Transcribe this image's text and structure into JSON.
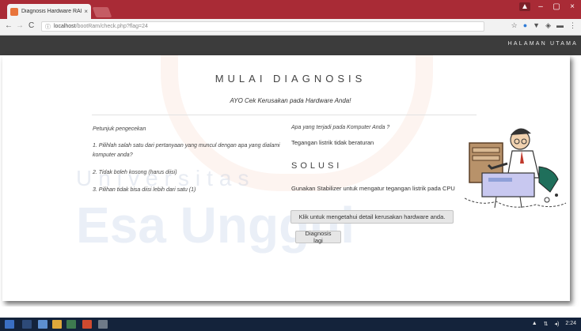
{
  "browser": {
    "tab_title": "Diagnosis Hardware RAI",
    "tab_close": "×",
    "url_host": "localhost",
    "url_path": "/bootRam/check.php?flag=24",
    "nav_back": "←",
    "nav_forward": "→",
    "nav_reload": "C",
    "info_icon": "ⓘ",
    "window_controls": {
      "minimize": "–",
      "maximize": "▢",
      "close": "×"
    },
    "extensions": [
      "☆",
      "●",
      "▼",
      "◈",
      "▬",
      "⋮"
    ]
  },
  "navbar": {
    "link": "HALAMAN UTAMA"
  },
  "page": {
    "title": "MULAI DIAGNOSIS",
    "subtitle": "AYO Cek Kerusakan pada Hardware Anda!",
    "instructions": {
      "heading": "Petunjuk pengecekan",
      "items": [
        "1. Pilihlah salah satu dari pertanyaan yang muncul dengan apa yang dialami komputer anda?",
        "2. Tidak boleh kosong (harus diisi)",
        "3. Pilihan tidak bisa diisi lebih dari satu (1)"
      ]
    },
    "question": "Apa yang terjadi pada Komputer Anda ?",
    "answer": "Tegangan listrik tidak beraturan",
    "solusi_heading": "SOLUSI",
    "solusi_text": "Gunakan Stabilizer untuk mengatur tegangan listrik pada CPU",
    "detail_button": "Klik untuk mengetahui detail kerusakan hardware anda.",
    "again_button": "Diagnosis lagi"
  },
  "watermark": {
    "line1": "Universitas",
    "line2": "Esa Unggul"
  },
  "taskbar": {
    "clock": "2:24",
    "tray": [
      "▲",
      "⇅",
      "◂)"
    ]
  },
  "colors": {
    "tab_strip": "#a92b36",
    "navbar": "#3c3c3c",
    "taskbar": "#14233b"
  }
}
